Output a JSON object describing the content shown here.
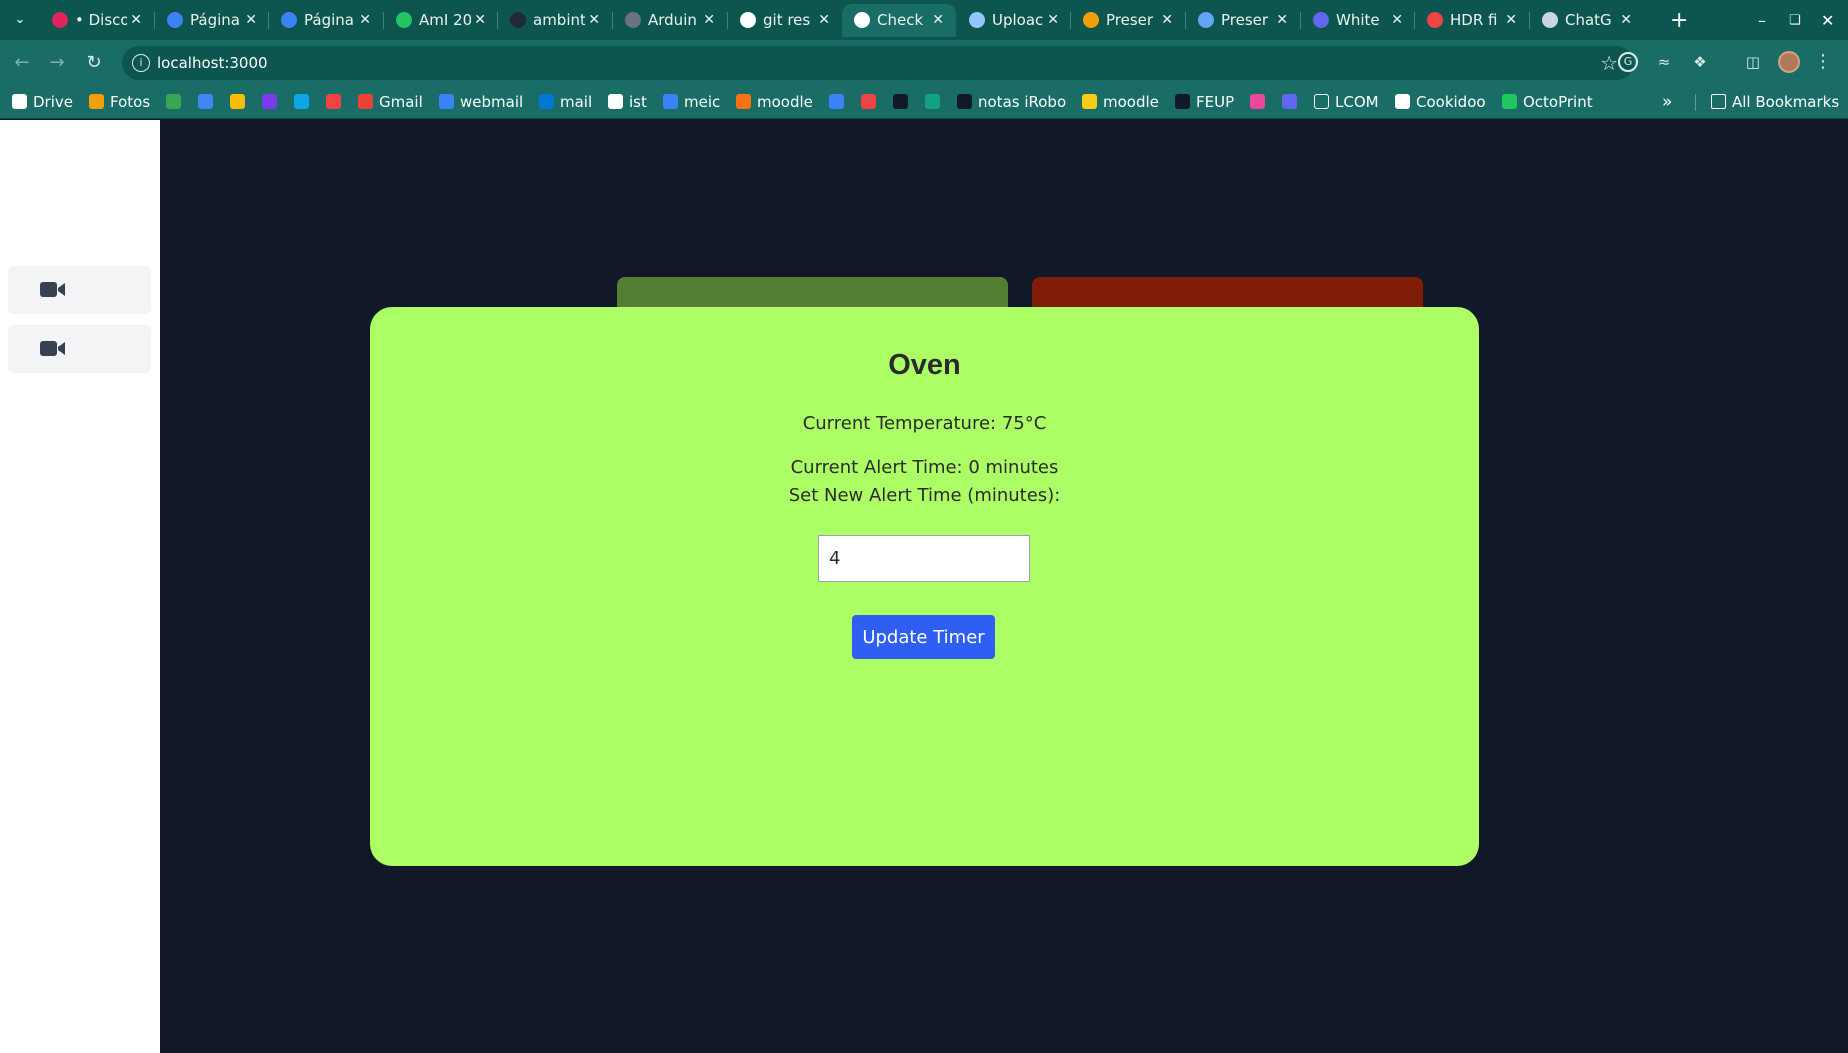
{
  "browser": {
    "tabs": [
      {
        "title": "• Disco",
        "favicon_color": "#e0245e",
        "active": false
      },
      {
        "title": "Página",
        "favicon_color": "#3b82f6",
        "active": false
      },
      {
        "title": "Página",
        "favicon_color": "#3b82f6",
        "active": false
      },
      {
        "title": "AmI 20",
        "favicon_color": "#22c55e",
        "active": false
      },
      {
        "title": "ambint",
        "favicon_color": "#1f2937",
        "active": false
      },
      {
        "title": "Arduin",
        "favicon_color": "#6b7280",
        "active": false
      },
      {
        "title": "git res",
        "favicon_color": "#ffffff",
        "active": false
      },
      {
        "title": "Check",
        "favicon_color": "#ffffff",
        "active": true
      },
      {
        "title": "Uploac",
        "favicon_color": "#93c5fd",
        "active": false
      },
      {
        "title": "Preser",
        "favicon_color": "#f59e0b",
        "active": false
      },
      {
        "title": "Preser",
        "favicon_color": "#60a5fa",
        "active": false
      },
      {
        "title": "White",
        "favicon_color": "#6366f1",
        "active": false
      },
      {
        "title": "HDR fi",
        "favicon_color": "#ef4444",
        "active": false
      },
      {
        "title": "ChatG",
        "favicon_color": "#cbd5e1",
        "active": false
      }
    ],
    "url": "localhost:3000",
    "bookmarks": [
      {
        "label": "Drive",
        "icon_color": "#ffffff"
      },
      {
        "label": "Fotos",
        "icon_color": "#f59e0b"
      },
      {
        "label": "",
        "icon_color": "#34a853"
      },
      {
        "label": "",
        "icon_color": "#4285f4"
      },
      {
        "label": "",
        "icon_color": "#fbbc04"
      },
      {
        "label": "",
        "icon_color": "#7c3aed"
      },
      {
        "label": "",
        "icon_color": "#0ea5e9"
      },
      {
        "label": "",
        "icon_color": "#ef4444"
      },
      {
        "label": "Gmail",
        "icon_color": "#ea4335"
      },
      {
        "label": "webmail",
        "icon_color": "#3b82f6"
      },
      {
        "label": "mail",
        "icon_color": "#0078d4"
      },
      {
        "label": "ist",
        "icon_color": "#ffffff"
      },
      {
        "label": "meic",
        "icon_color": "#3b82f6"
      },
      {
        "label": "moodle",
        "icon_color": "#f97316"
      },
      {
        "label": "",
        "icon_color": "#3b82f6"
      },
      {
        "label": "",
        "icon_color": "#ef4444"
      },
      {
        "label": "",
        "icon_color": "#111827"
      },
      {
        "label": "",
        "icon_color": "#10a37f"
      },
      {
        "label": "notas iRobo",
        "icon_color": "#111827"
      },
      {
        "label": "moodle",
        "icon_color": "#facc15"
      },
      {
        "label": "FEUP",
        "icon_color": "#111827"
      },
      {
        "label": "",
        "icon_color": "#ec4899"
      },
      {
        "label": "",
        "icon_color": "#6366f1"
      },
      {
        "label": "LCOM",
        "icon_color": "folder"
      },
      {
        "label": "Cookidoo",
        "icon_color": "#ffffff"
      },
      {
        "label": "OctoPrint",
        "icon_color": "#22c55e"
      }
    ],
    "all_bookmarks": "All Bookmarks"
  },
  "sidebar": {
    "items": [
      {
        "icon": "video-camera-icon"
      },
      {
        "icon": "video-camera-icon"
      }
    ]
  },
  "tab_cards": {
    "left_color": "#547f33",
    "right_color": "#7f1d06"
  },
  "device": {
    "name": "Oven",
    "temperature_text": "Current Temperature: 75°C",
    "alert_time_text": "Current Alert Time: 0 minutes",
    "new_alert_label": "Set New Alert Time (minutes):",
    "input_value": "4",
    "update_button": "Update Timer",
    "card_color": "#adff66",
    "button_color": "#2f5ff2"
  }
}
